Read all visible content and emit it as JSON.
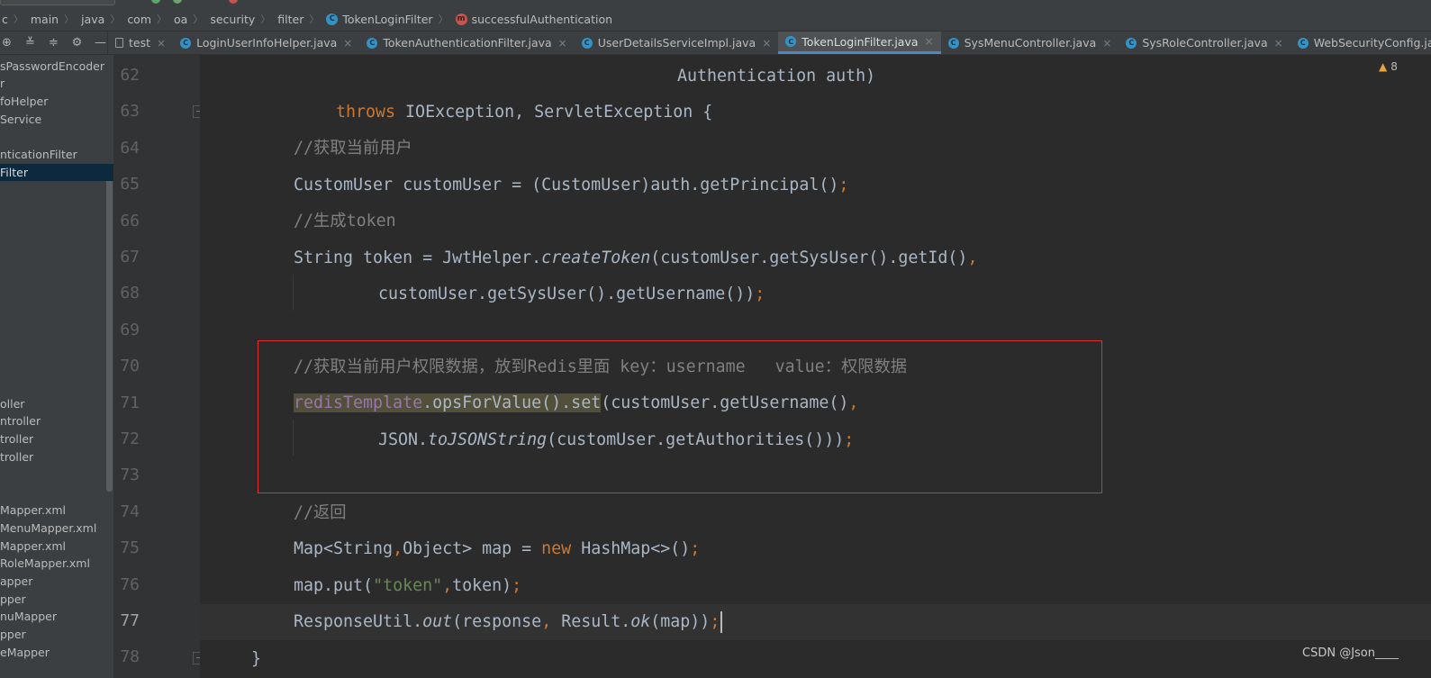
{
  "breadcrumb": [
    {
      "label": "c",
      "icon": "none"
    },
    {
      "label": "main",
      "icon": "none"
    },
    {
      "label": "java",
      "icon": "none"
    },
    {
      "label": "com",
      "icon": "none"
    },
    {
      "label": "oa",
      "icon": "none"
    },
    {
      "label": "security",
      "icon": "none"
    },
    {
      "label": "filter",
      "icon": "none"
    },
    {
      "label": "TokenLoginFilter",
      "icon": "class-icon"
    },
    {
      "label": "successfulAuthentication",
      "icon": "method-icon"
    }
  ],
  "icons": {
    "class_glyph": "C",
    "method_glyph": "m",
    "close_glyph": "×",
    "warning_glyph": "▲"
  },
  "tabs": [
    {
      "label": "test",
      "icon": "file",
      "active": false
    },
    {
      "label": "LoginUserInfoHelper.java",
      "icon": "class",
      "active": false
    },
    {
      "label": "TokenAuthenticationFilter.java",
      "icon": "class",
      "active": false
    },
    {
      "label": "UserDetailsServiceImpl.java",
      "icon": "class",
      "active": false
    },
    {
      "label": "TokenLoginFilter.java",
      "icon": "class",
      "active": true
    },
    {
      "label": "SysMenuController.java",
      "icon": "class",
      "active": false
    },
    {
      "label": "SysRoleController.java",
      "icon": "class",
      "active": false
    },
    {
      "label": "WebSecurityConfig.java",
      "icon": "class",
      "active": false
    }
  ],
  "sidebar": {
    "items": [
      {
        "label": "sPasswordEncoder",
        "selected": false
      },
      {
        "label": "r",
        "selected": false
      },
      {
        "label": "foHelper",
        "selected": false
      },
      {
        "label": "Service",
        "selected": false
      },
      {
        "label": "nticationFilter",
        "selected": false
      },
      {
        "label": "Filter",
        "selected": true
      },
      {
        "label": "oller",
        "selected": false
      },
      {
        "label": "ntroller",
        "selected": false
      },
      {
        "label": "troller",
        "selected": false
      },
      {
        "label": "troller",
        "selected": false
      },
      {
        "label": "Mapper.xml",
        "selected": false
      },
      {
        "label": "MenuMapper.xml",
        "selected": false
      },
      {
        "label": "Mapper.xml",
        "selected": false
      },
      {
        "label": "RoleMapper.xml",
        "selected": false
      },
      {
        "label": "apper",
        "selected": false
      },
      {
        "label": "pper",
        "selected": false
      },
      {
        "label": "nuMapper",
        "selected": false
      },
      {
        "label": "pper",
        "selected": false
      },
      {
        "label": "eMapper",
        "selected": false
      }
    ]
  },
  "editor": {
    "line_numbers": [
      "62",
      "63",
      "64",
      "65",
      "66",
      "67",
      "68",
      "69",
      "70",
      "71",
      "72",
      "73",
      "74",
      "75",
      "76",
      "77",
      "78"
    ],
    "current_line": "77",
    "tokens": {
      "l62": "Authentication auth)",
      "l63_kw": "throws",
      "l63_rest": " IOException, ServletException {",
      "l64": "//获取当前用户",
      "l65": "CustomUser customUser = (CustomUser)auth.getPrincipal()",
      "l66": "//生成token",
      "l67_a": "String token = JwtHelper.",
      "l67_b": "createToken",
      "l67_c": "(customUser.getSysUser().getId()",
      "l68": "customUser.getSysUser().getUsername())",
      "l70": "//获取当前用户权限数据，放到Redis里面 key：username   value：权限数据",
      "l71_field": "redisTemplate",
      "l71_hl_rest": ".opsForValue().set",
      "l71_rest": "(customUser.getUsername()",
      "l72_a": "JSON.",
      "l72_b": "toJSONString",
      "l72_c": "(customUser.getAuthorities()))",
      "l74": "//返回",
      "l75_a": "Map<String",
      "l75_b": "Object> map = ",
      "l75_new": "new",
      "l75_c": " HashMap<>()",
      "l76_a": "map.put(",
      "l76_str": "\"token\"",
      "l76_c": "token)",
      "l77_a": "ResponseUtil.",
      "l77_b": "out",
      "l77_c": "(response",
      "l77_d": " Result.",
      "l77_e": "ok",
      "l77_f": "(map))",
      "l78": "}",
      "comma": ",",
      "semi": ";"
    }
  },
  "inspections": {
    "warning_count": "8"
  },
  "watermark": "CSDN @Json____"
}
